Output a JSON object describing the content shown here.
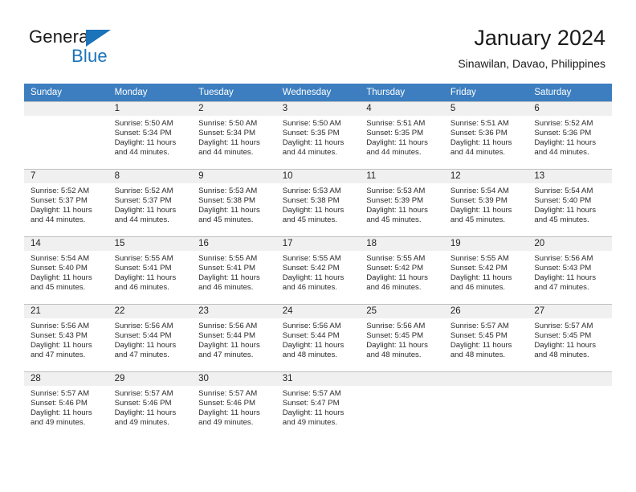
{
  "brand": {
    "name_part1": "General",
    "name_part2": "Blue",
    "flag_icon": "triangle-flag-icon",
    "accent_color": "#1b73ba"
  },
  "header": {
    "month_title": "January 2024",
    "location": "Sinawilan, Davao, Philippines"
  },
  "calendar": {
    "header_bg": "#3c7ebf",
    "daynum_bg": "#f0f0f0",
    "weekdays": [
      "Sunday",
      "Monday",
      "Tuesday",
      "Wednesday",
      "Thursday",
      "Friday",
      "Saturday"
    ],
    "weeks": [
      [
        {
          "day": "",
          "sunrise": "",
          "sunset": "",
          "daylight_line1": "",
          "daylight_line2": ""
        },
        {
          "day": "1",
          "sunrise": "Sunrise: 5:50 AM",
          "sunset": "Sunset: 5:34 PM",
          "daylight_line1": "Daylight: 11 hours",
          "daylight_line2": "and 44 minutes."
        },
        {
          "day": "2",
          "sunrise": "Sunrise: 5:50 AM",
          "sunset": "Sunset: 5:34 PM",
          "daylight_line1": "Daylight: 11 hours",
          "daylight_line2": "and 44 minutes."
        },
        {
          "day": "3",
          "sunrise": "Sunrise: 5:50 AM",
          "sunset": "Sunset: 5:35 PM",
          "daylight_line1": "Daylight: 11 hours",
          "daylight_line2": "and 44 minutes."
        },
        {
          "day": "4",
          "sunrise": "Sunrise: 5:51 AM",
          "sunset": "Sunset: 5:35 PM",
          "daylight_line1": "Daylight: 11 hours",
          "daylight_line2": "and 44 minutes."
        },
        {
          "day": "5",
          "sunrise": "Sunrise: 5:51 AM",
          "sunset": "Sunset: 5:36 PM",
          "daylight_line1": "Daylight: 11 hours",
          "daylight_line2": "and 44 minutes."
        },
        {
          "day": "6",
          "sunrise": "Sunrise: 5:52 AM",
          "sunset": "Sunset: 5:36 PM",
          "daylight_line1": "Daylight: 11 hours",
          "daylight_line2": "and 44 minutes."
        }
      ],
      [
        {
          "day": "7",
          "sunrise": "Sunrise: 5:52 AM",
          "sunset": "Sunset: 5:37 PM",
          "daylight_line1": "Daylight: 11 hours",
          "daylight_line2": "and 44 minutes."
        },
        {
          "day": "8",
          "sunrise": "Sunrise: 5:52 AM",
          "sunset": "Sunset: 5:37 PM",
          "daylight_line1": "Daylight: 11 hours",
          "daylight_line2": "and 44 minutes."
        },
        {
          "day": "9",
          "sunrise": "Sunrise: 5:53 AM",
          "sunset": "Sunset: 5:38 PM",
          "daylight_line1": "Daylight: 11 hours",
          "daylight_line2": "and 45 minutes."
        },
        {
          "day": "10",
          "sunrise": "Sunrise: 5:53 AM",
          "sunset": "Sunset: 5:38 PM",
          "daylight_line1": "Daylight: 11 hours",
          "daylight_line2": "and 45 minutes."
        },
        {
          "day": "11",
          "sunrise": "Sunrise: 5:53 AM",
          "sunset": "Sunset: 5:39 PM",
          "daylight_line1": "Daylight: 11 hours",
          "daylight_line2": "and 45 minutes."
        },
        {
          "day": "12",
          "sunrise": "Sunrise: 5:54 AM",
          "sunset": "Sunset: 5:39 PM",
          "daylight_line1": "Daylight: 11 hours",
          "daylight_line2": "and 45 minutes."
        },
        {
          "day": "13",
          "sunrise": "Sunrise: 5:54 AM",
          "sunset": "Sunset: 5:40 PM",
          "daylight_line1": "Daylight: 11 hours",
          "daylight_line2": "and 45 minutes."
        }
      ],
      [
        {
          "day": "14",
          "sunrise": "Sunrise: 5:54 AM",
          "sunset": "Sunset: 5:40 PM",
          "daylight_line1": "Daylight: 11 hours",
          "daylight_line2": "and 45 minutes."
        },
        {
          "day": "15",
          "sunrise": "Sunrise: 5:55 AM",
          "sunset": "Sunset: 5:41 PM",
          "daylight_line1": "Daylight: 11 hours",
          "daylight_line2": "and 46 minutes."
        },
        {
          "day": "16",
          "sunrise": "Sunrise: 5:55 AM",
          "sunset": "Sunset: 5:41 PM",
          "daylight_line1": "Daylight: 11 hours",
          "daylight_line2": "and 46 minutes."
        },
        {
          "day": "17",
          "sunrise": "Sunrise: 5:55 AM",
          "sunset": "Sunset: 5:42 PM",
          "daylight_line1": "Daylight: 11 hours",
          "daylight_line2": "and 46 minutes."
        },
        {
          "day": "18",
          "sunrise": "Sunrise: 5:55 AM",
          "sunset": "Sunset: 5:42 PM",
          "daylight_line1": "Daylight: 11 hours",
          "daylight_line2": "and 46 minutes."
        },
        {
          "day": "19",
          "sunrise": "Sunrise: 5:55 AM",
          "sunset": "Sunset: 5:42 PM",
          "daylight_line1": "Daylight: 11 hours",
          "daylight_line2": "and 46 minutes."
        },
        {
          "day": "20",
          "sunrise": "Sunrise: 5:56 AM",
          "sunset": "Sunset: 5:43 PM",
          "daylight_line1": "Daylight: 11 hours",
          "daylight_line2": "and 47 minutes."
        }
      ],
      [
        {
          "day": "21",
          "sunrise": "Sunrise: 5:56 AM",
          "sunset": "Sunset: 5:43 PM",
          "daylight_line1": "Daylight: 11 hours",
          "daylight_line2": "and 47 minutes."
        },
        {
          "day": "22",
          "sunrise": "Sunrise: 5:56 AM",
          "sunset": "Sunset: 5:44 PM",
          "daylight_line1": "Daylight: 11 hours",
          "daylight_line2": "and 47 minutes."
        },
        {
          "day": "23",
          "sunrise": "Sunrise: 5:56 AM",
          "sunset": "Sunset: 5:44 PM",
          "daylight_line1": "Daylight: 11 hours",
          "daylight_line2": "and 47 minutes."
        },
        {
          "day": "24",
          "sunrise": "Sunrise: 5:56 AM",
          "sunset": "Sunset: 5:44 PM",
          "daylight_line1": "Daylight: 11 hours",
          "daylight_line2": "and 48 minutes."
        },
        {
          "day": "25",
          "sunrise": "Sunrise: 5:56 AM",
          "sunset": "Sunset: 5:45 PM",
          "daylight_line1": "Daylight: 11 hours",
          "daylight_line2": "and 48 minutes."
        },
        {
          "day": "26",
          "sunrise": "Sunrise: 5:57 AM",
          "sunset": "Sunset: 5:45 PM",
          "daylight_line1": "Daylight: 11 hours",
          "daylight_line2": "and 48 minutes."
        },
        {
          "day": "27",
          "sunrise": "Sunrise: 5:57 AM",
          "sunset": "Sunset: 5:45 PM",
          "daylight_line1": "Daylight: 11 hours",
          "daylight_line2": "and 48 minutes."
        }
      ],
      [
        {
          "day": "28",
          "sunrise": "Sunrise: 5:57 AM",
          "sunset": "Sunset: 5:46 PM",
          "daylight_line1": "Daylight: 11 hours",
          "daylight_line2": "and 49 minutes."
        },
        {
          "day": "29",
          "sunrise": "Sunrise: 5:57 AM",
          "sunset": "Sunset: 5:46 PM",
          "daylight_line1": "Daylight: 11 hours",
          "daylight_line2": "and 49 minutes."
        },
        {
          "day": "30",
          "sunrise": "Sunrise: 5:57 AM",
          "sunset": "Sunset: 5:46 PM",
          "daylight_line1": "Daylight: 11 hours",
          "daylight_line2": "and 49 minutes."
        },
        {
          "day": "31",
          "sunrise": "Sunrise: 5:57 AM",
          "sunset": "Sunset: 5:47 PM",
          "daylight_line1": "Daylight: 11 hours",
          "daylight_line2": "and 49 minutes."
        },
        {
          "day": "",
          "sunrise": "",
          "sunset": "",
          "daylight_line1": "",
          "daylight_line2": ""
        },
        {
          "day": "",
          "sunrise": "",
          "sunset": "",
          "daylight_line1": "",
          "daylight_line2": ""
        },
        {
          "day": "",
          "sunrise": "",
          "sunset": "",
          "daylight_line1": "",
          "daylight_line2": ""
        }
      ]
    ]
  }
}
